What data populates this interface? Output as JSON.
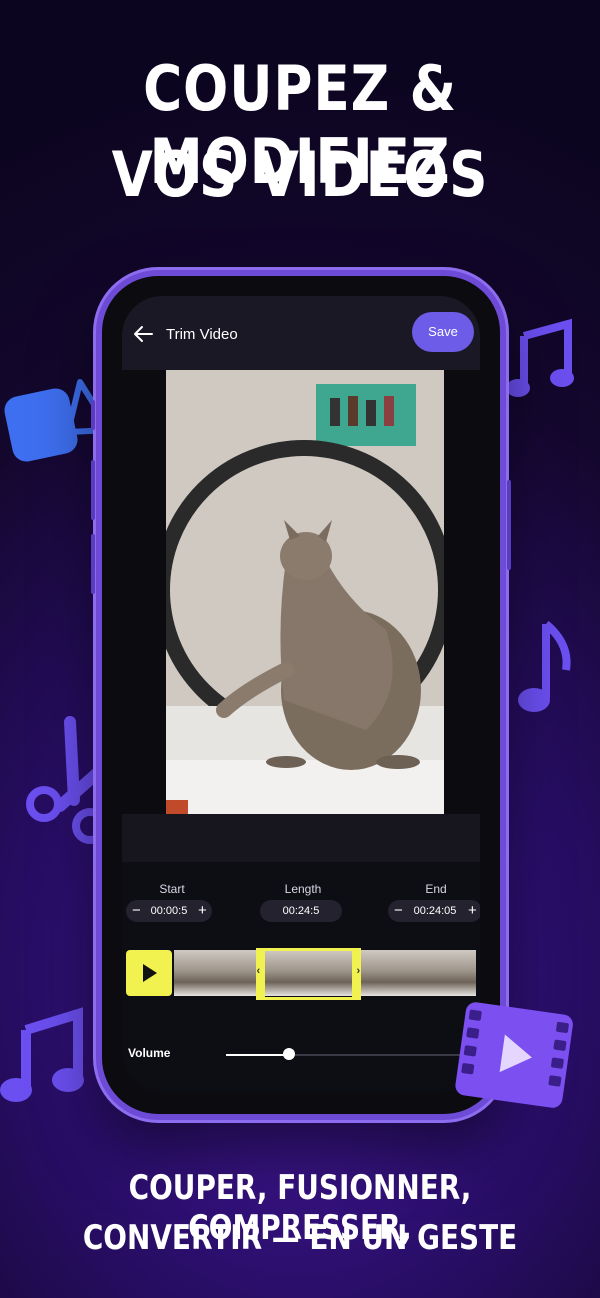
{
  "headline": {
    "line1": "COUPEZ & MODIFIEZ",
    "line2": "VOS VIDÉOS"
  },
  "app": {
    "title": "Trim Video",
    "save_label": "Save",
    "start_label": "Start",
    "start_value": "00:00:5",
    "length_label": "Length",
    "length_value": "00:24:5",
    "end_label": "End",
    "end_value": "00:24:05",
    "minus": "−",
    "plus": "+",
    "volume_label": "Volume",
    "volume_level": 0.25,
    "selection_start": 0.27,
    "selection_end": 0.62
  },
  "tagline": {
    "line1": "COUPER, FUSIONNER, COMPRESSER,",
    "line2": "CONVERTIR — EN UN GESTE"
  },
  "colors": {
    "accent": "#6c5ce7",
    "highlight": "#f1f250",
    "decor": "#6b4ff0"
  },
  "icons": [
    "video-camera-icon",
    "music-note-icon",
    "scissors-icon",
    "film-play-icon",
    "back-arrow-icon",
    "play-icon"
  ]
}
